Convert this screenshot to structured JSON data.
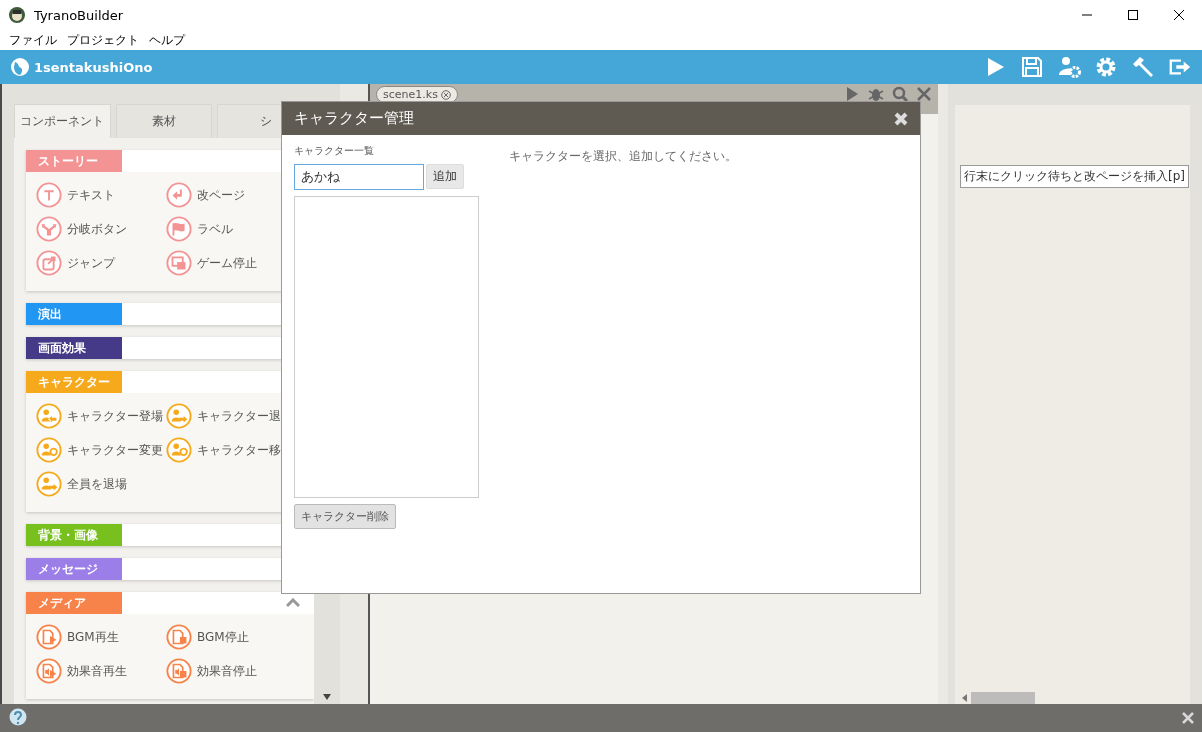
{
  "window": {
    "title": "TyranoBuilder"
  },
  "menu": [
    "ファイル",
    "プロジェクト",
    "ヘルプ"
  ],
  "project": {
    "name": "1sentakushiOno",
    "tools": [
      {
        "kind": "play"
      },
      {
        "kind": "save"
      },
      {
        "kind": "user-gear"
      },
      {
        "kind": "gear"
      },
      {
        "kind": "hammer"
      },
      {
        "kind": "exit"
      }
    ]
  },
  "palette": {
    "tabs": [
      {
        "label": "コンポーネント",
        "selected": true
      },
      {
        "label": "素材",
        "selected": false
      },
      {
        "label": "シ",
        "selected": false
      }
    ],
    "sections": [
      {
        "title": "ストーリー",
        "color": "#f39393",
        "expanded": true,
        "items": [
          {
            "label": "テキスト",
            "kind": "text"
          },
          {
            "label": "改ページ",
            "kind": "return"
          },
          {
            "label": "分岐ボタン",
            "kind": "fork"
          },
          {
            "label": "ラベル",
            "kind": "flag"
          },
          {
            "label": "ジャンプ",
            "kind": "jump"
          },
          {
            "label": "ゲーム停止",
            "kind": "screens"
          }
        ]
      },
      {
        "title": "演出",
        "color": "#2196f3",
        "expanded": false
      },
      {
        "title": "画面効果",
        "color": "#453a87",
        "expanded": false
      },
      {
        "title": "キャラクター",
        "color": "#f5a91b",
        "expanded": true,
        "items": [
          {
            "label": "キャラクター登場",
            "kind": "person-in"
          },
          {
            "label": "キャラクター退",
            "kind": "person-out"
          },
          {
            "label": "キャラクター変更",
            "kind": "person-cycle"
          },
          {
            "label": "キャラクター移",
            "kind": "person-cycle"
          },
          {
            "label": "全員を退場",
            "kind": "person-out"
          }
        ]
      },
      {
        "title": "背景・画像",
        "color": "#78c01e",
        "expanded": false
      },
      {
        "title": "メッセージ",
        "color": "#9c7ee8",
        "expanded": false
      },
      {
        "title": "メディア",
        "color": "#f7834a",
        "expanded": true,
        "items": [
          {
            "label": "BGM再生",
            "kind": "file-play"
          },
          {
            "label": "BGM停止",
            "kind": "file-stop"
          },
          {
            "label": "効果音再生",
            "kind": "sound-play"
          },
          {
            "label": "効果音停止",
            "kind": "sound-stop"
          }
        ]
      }
    ]
  },
  "editor": {
    "tab": "scene1.ks"
  },
  "hint": "行末にクリック待ちと改ページを挿入[p]",
  "dialog": {
    "title": "キャラクター管理",
    "list_label": "キャラクター一覧",
    "name_value": "あかね",
    "add_button": "追加",
    "delete_button": "キャラクター削除",
    "message": "キャラクターを選択、追加してください。"
  }
}
